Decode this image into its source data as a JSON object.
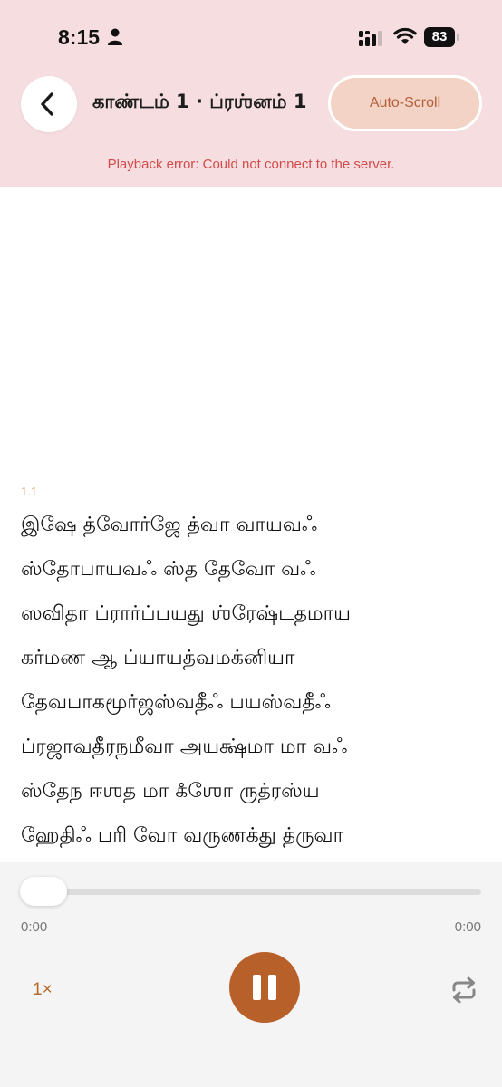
{
  "status_bar": {
    "time": "8:15",
    "battery": "83",
    "icons": [
      "person-icon",
      "cellular-signal-icon",
      "wifi-icon",
      "battery-icon"
    ]
  },
  "header": {
    "back_icon": "chevron-left-icon",
    "title": "காண்டம் 1 · ப்ரஶ்னம் 1",
    "auto_scroll_label": "Auto-Scroll",
    "error_message": "Playback error: Could not connect to the server."
  },
  "content": {
    "verse_number": "1.1",
    "lines": [
      "இஷே த்வோர்ஜே த்வா வாயவஃ",
      "ஸ்தோபாயவஃ ஸ்த தேவோ வஃ",
      "ஸவிதா ப்ரார்ப்பயது ஶ்ரேஷ்டதமாய",
      "கர்மண ஆ ப்யாயத்வமக்னியா",
      "தேவபாகமூர்ஜஸ்வதீஃ பயஸ்வதீஃ",
      "ப்ரஜாவதீரநமீவா அயக்ஷ்மா மா வஃ",
      "ஸ்தேந ஈஶத மா கஂஶோ ருத்ரஸ்ய",
      "ஹேதிஃ பரி வோ வருணக்து த்ருவா"
    ]
  },
  "player": {
    "progress": 0,
    "current_time": "0:00",
    "duration": "0:00",
    "speed_label": "1×",
    "play_state_icon": "pause-icon",
    "repeat_icon": "repeat-icon",
    "colors": {
      "accent": "#b8602a",
      "header_bg": "#f6dddf",
      "error": "#d24b4b",
      "verse_number": "#d4a86a"
    }
  }
}
